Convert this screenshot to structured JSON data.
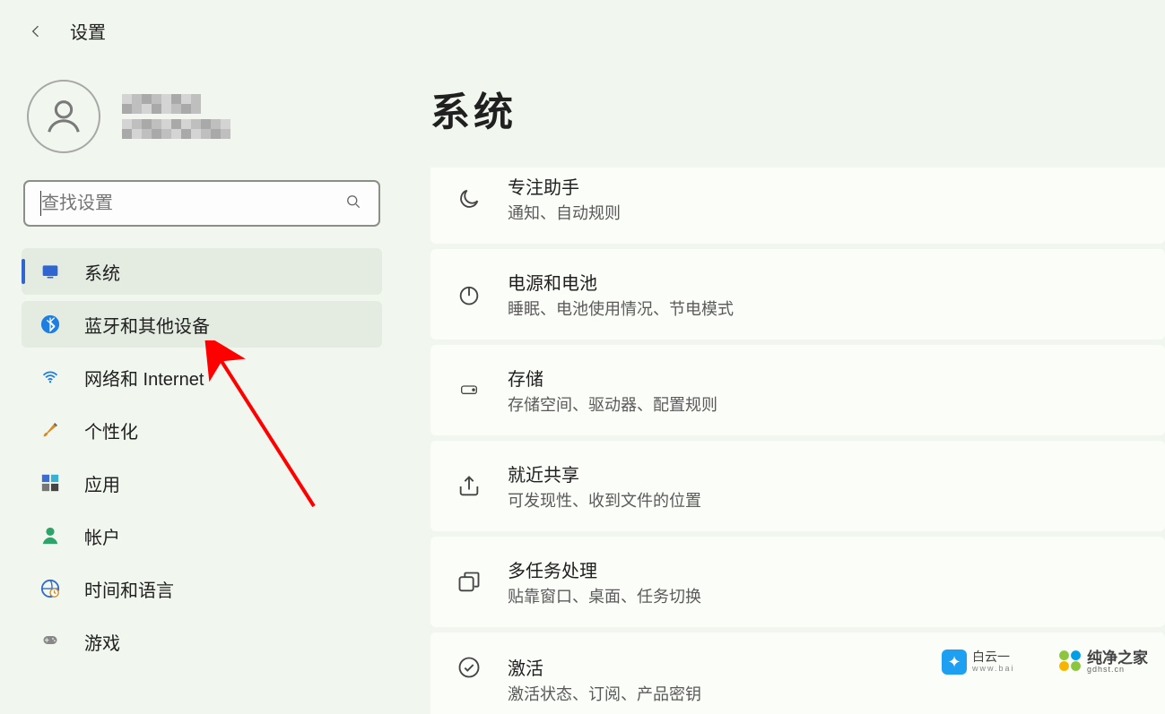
{
  "topbar": {
    "title": "设置"
  },
  "search": {
    "placeholder": "查找设置"
  },
  "nav": {
    "items": [
      {
        "id": "system",
        "label": "系统"
      },
      {
        "id": "bluetooth",
        "label": "蓝牙和其他设备"
      },
      {
        "id": "network",
        "label": "网络和 Internet"
      },
      {
        "id": "personalization",
        "label": "个性化"
      },
      {
        "id": "apps",
        "label": "应用"
      },
      {
        "id": "accounts",
        "label": "帐户"
      },
      {
        "id": "time-lang",
        "label": "时间和语言"
      },
      {
        "id": "gaming",
        "label": "游戏"
      }
    ]
  },
  "page": {
    "title": "系统"
  },
  "cards": [
    {
      "id": "focus",
      "title": "专注助手",
      "desc": "通知、自动规则"
    },
    {
      "id": "power",
      "title": "电源和电池",
      "desc": "睡眠、电池使用情况、节电模式"
    },
    {
      "id": "storage",
      "title": "存储",
      "desc": "存储空间、驱动器、配置规则"
    },
    {
      "id": "nearby",
      "title": "就近共享",
      "desc": "可发现性、收到文件的位置"
    },
    {
      "id": "multitask",
      "title": "多任务处理",
      "desc": "贴靠窗口、桌面、任务切换"
    },
    {
      "id": "activation",
      "title": "激活",
      "desc": "激活状态、订阅、产品密钥"
    }
  ],
  "watermarks": {
    "wm1_text": "白云一",
    "wm1_sub": "www.bai",
    "wm2_text": "纯净之家",
    "wm2_sub": "gdhst.cn"
  }
}
